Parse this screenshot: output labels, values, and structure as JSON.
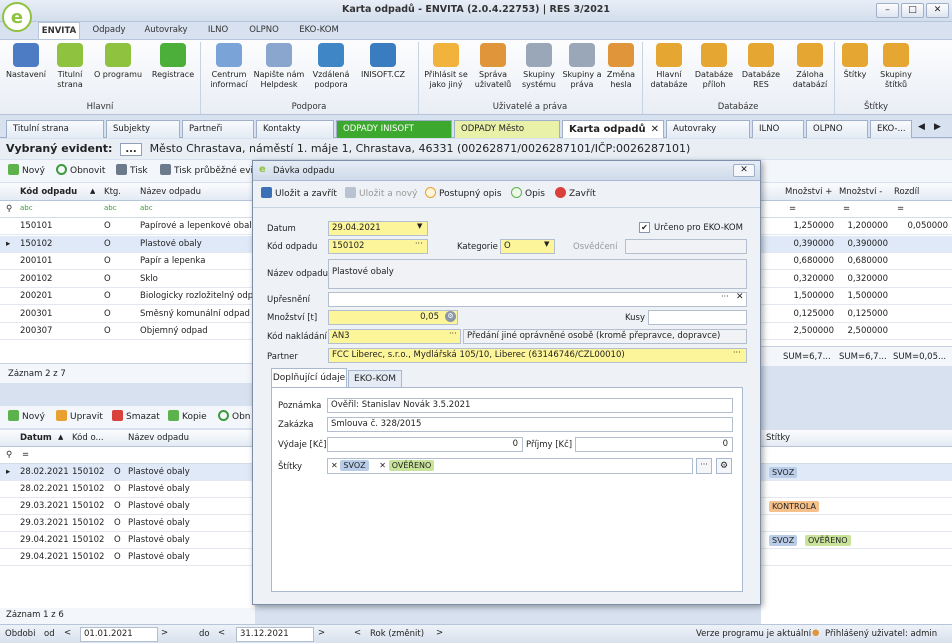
{
  "app": {
    "title": "Karta odpadů - ENVITA (2.0.4.22753) | RES 3/2021",
    "logo_glyph": "e"
  },
  "window_buttons": [
    "–",
    "□",
    "✕"
  ],
  "ribbon_tabs": [
    "ENVITA",
    "Odpady",
    "Autovraky",
    "ILNO",
    "OLPNO",
    "EKO-KOM"
  ],
  "ribbon": {
    "groups": [
      "Hlavní",
      "Podpora",
      "Uživatelé a práva",
      "Databáze",
      "Štítky"
    ],
    "buttons": [
      {
        "label": "Nastavení",
        "icon": "gears-icon",
        "color": "#4d7cc4"
      },
      {
        "label": "Titulní strana",
        "icon": "envita-logo-icon",
        "color": "#8fc23f"
      },
      {
        "label": "O programu",
        "icon": "info-icon",
        "color": "#8fc23f"
      },
      {
        "label": "Registrace",
        "icon": "check-badge-icon",
        "color": "#4caf3a"
      },
      {
        "label": "Centrum informací",
        "icon": "ci-icon",
        "color": "#7aa3d8"
      },
      {
        "label": "Napište nám Helpdesk",
        "icon": "mail-icon",
        "color": "#8aa6cf"
      },
      {
        "label": "Vzdálená podpora",
        "icon": "monitor-icon",
        "color": "#3f86c6"
      },
      {
        "label": "INISOFT.CZ",
        "icon": "inisoft-icon",
        "color": "#3a7cc0"
      },
      {
        "label": "Přihlásit se jako jiný",
        "icon": "user-switch-icon",
        "color": "#f2b33d"
      },
      {
        "label": "Správa uživatelů",
        "icon": "users-icon",
        "color": "#e0953a"
      },
      {
        "label": "Skupiny systému",
        "icon": "group-icon",
        "color": "#9aa7b8"
      },
      {
        "label": "Skupiny a práva",
        "icon": "group-rights-icon",
        "color": "#9aa7b8"
      },
      {
        "label": "Změna hesla",
        "icon": "user-key-icon",
        "color": "#e0953a"
      },
      {
        "label": "Hlavní databáze",
        "icon": "database-icon",
        "color": "#e6a732"
      },
      {
        "label": "Databáze příloh",
        "icon": "database-attach-icon",
        "color": "#e6a732"
      },
      {
        "label": "Databáze RES",
        "icon": "database-res-icon",
        "color": "#e6a732"
      },
      {
        "label": "Záloha databází",
        "icon": "backup-icon",
        "color": "#e6a732"
      },
      {
        "label": "Štítky",
        "icon": "tags-icon",
        "color": "#e6a732"
      },
      {
        "label": "Skupiny štítků",
        "icon": "tag-groups-icon",
        "color": "#e6a732"
      }
    ]
  },
  "doc_tabs": [
    "Titulní strana",
    "Subjekty",
    "Partneři",
    "Kontakty",
    "ODPADY INISOFT",
    "ODPADY Město",
    "Karta odpadů",
    "Autovraky",
    "ILNO",
    "OLPNO",
    "EKO-..."
  ],
  "evident": {
    "label": "Vybraný evident:",
    "button": "...",
    "value": "Město Chrastava, náměstí 1. máje 1, Chrastava, 46331 (00262871/0026287101/IČP:0026287101)"
  },
  "top_toolbar": [
    "Nový",
    "Obnovit",
    "Tisk",
    "Tisk průběžné evid"
  ],
  "top_grid": {
    "columns": [
      "Kód odpadu",
      "Ktg.",
      "Název odpadu"
    ],
    "right_columns": [
      "Množství +",
      "Množství -",
      "Rozdíl"
    ],
    "filter_icon": "abc",
    "rows": [
      {
        "kod": "150101",
        "ktg": "O",
        "nazev": "Papírové a lepenkové obaly",
        "plus": "1,250000",
        "minus": "1,200000",
        "rozdil": "0,050000"
      },
      {
        "kod": "150102",
        "ktg": "O",
        "nazev": "Plastové obaly",
        "plus": "0,390000",
        "minus": "0,390000",
        "rozdil": ""
      },
      {
        "kod": "200101",
        "ktg": "O",
        "nazev": "Papír a lepenka",
        "plus": "0,680000",
        "minus": "0,680000",
        "rozdil": ""
      },
      {
        "kod": "200102",
        "ktg": "O",
        "nazev": "Sklo",
        "plus": "0,320000",
        "minus": "0,320000",
        "rozdil": ""
      },
      {
        "kod": "200201",
        "ktg": "O",
        "nazev": "Biologicky rozložitelný odpad",
        "plus": "1,500000",
        "minus": "1,500000",
        "rozdil": ""
      },
      {
        "kod": "200301",
        "ktg": "O",
        "nazev": "Směsný komunální odpad",
        "plus": "0,125000",
        "minus": "0,125000",
        "rozdil": ""
      },
      {
        "kod": "200307",
        "ktg": "O",
        "nazev": "Objemný odpad",
        "plus": "2,500000",
        "minus": "2,500000",
        "rozdil": ""
      }
    ],
    "sums": [
      "SUM=6,7...",
      "SUM=6,7...",
      "SUM=0,05..."
    ],
    "record_count": "Záznam 2 z 7"
  },
  "bottom_toolbar": [
    "Nový",
    "Upravit",
    "Smazat",
    "Kopie",
    "Obn"
  ],
  "bottom_grid": {
    "columns": [
      "Datum",
      "Kód o...",
      "",
      "Název odpadu"
    ],
    "right_column": "Štítky",
    "rows": [
      {
        "datum": "28.02.2021",
        "kod": "150102",
        "k": "O",
        "nazev": "Plastové obaly",
        "tags": [
          "SVOZ"
        ]
      },
      {
        "datum": "28.02.2021",
        "kod": "150102",
        "k": "O",
        "nazev": "Plastové obaly",
        "tags": []
      },
      {
        "datum": "29.03.2021",
        "kod": "150102",
        "k": "O",
        "nazev": "Plastové obaly",
        "tags": [
          "KONTROLA"
        ]
      },
      {
        "datum": "29.03.2021",
        "kod": "150102",
        "k": "O",
        "nazev": "Plastové obaly",
        "tags": []
      },
      {
        "datum": "29.04.2021",
        "kod": "150102",
        "k": "O",
        "nazev": "Plastové obaly",
        "tags": [
          "SVOZ",
          "OVĚŘENO"
        ]
      },
      {
        "datum": "29.04.2021",
        "kod": "150102",
        "k": "O",
        "nazev": "Plastové obaly",
        "tags": []
      }
    ],
    "record_count": "Záznam 1 z 6"
  },
  "footer": {
    "obdobi": "Období",
    "od": "od",
    "date_from": "01.01.2021",
    "do": "do",
    "date_to": "31.12.2021",
    "rok": "Rok (změnit)",
    "version_status": "Verze programu je aktuální",
    "user": "Přihlášený uživatel: admin"
  },
  "dialog": {
    "title": "Dávka odpadu",
    "toolbar": [
      "Uložit a zavřít",
      "Uložit a nový",
      "Postupný opis",
      "Opis",
      "Zavřít"
    ],
    "fields": {
      "datum_label": "Datum",
      "datum": "29.04.2021",
      "urceno_label": "Určeno pro EKO-KOM",
      "urceno_checked": true,
      "kod_label": "Kód odpadu",
      "kod": "150102",
      "kategorie_label": "Kategorie",
      "kategorie": "O",
      "osvedceni_label": "Osvědčení",
      "osvedceni": "",
      "nazev_label": "Název odpadu",
      "nazev": "Plastové obaly",
      "upresneni_label": "Upřesnění",
      "upresneni": "",
      "mnozstvi_label": "Množství [t]",
      "mnozstvi": "0,05",
      "kusy_label": "Kusy",
      "kusy": "",
      "nakladani_label": "Kód nakládání",
      "nakladani": "AN3",
      "nakladani_desc": "Předání jiné oprávněné osobě (kromě přepravce, dopravce)",
      "partner_label": "Partner",
      "partner": "FCC Liberec, s.r.o., Mydlářská 105/10, Liberec (63146746/CZL00010)"
    },
    "tabs": [
      "Doplňující údaje",
      "EKO-KOM"
    ],
    "extra": {
      "poznamka_label": "Poznámka",
      "poznamka": "Ověřil: Stanislav Novák 3.5.2021",
      "zakazka_label": "Zakázka",
      "zakazka": "Smlouva č. 328/2015",
      "vydaje_label": "Výdaje [Kč]",
      "vydaje": "0",
      "prijmy_label": "Příjmy [Kč]",
      "prijmy": "0",
      "stitky_label": "Štítky",
      "tags": [
        "SVOZ",
        "OVĚŘENO"
      ]
    }
  },
  "colors": {
    "svoz": "#b9cde8",
    "overeno": "#c9e39a",
    "kontrola": "#f6c08a",
    "green_tab": "#3ca82e",
    "yellow_tab": "#e9f0a8"
  }
}
